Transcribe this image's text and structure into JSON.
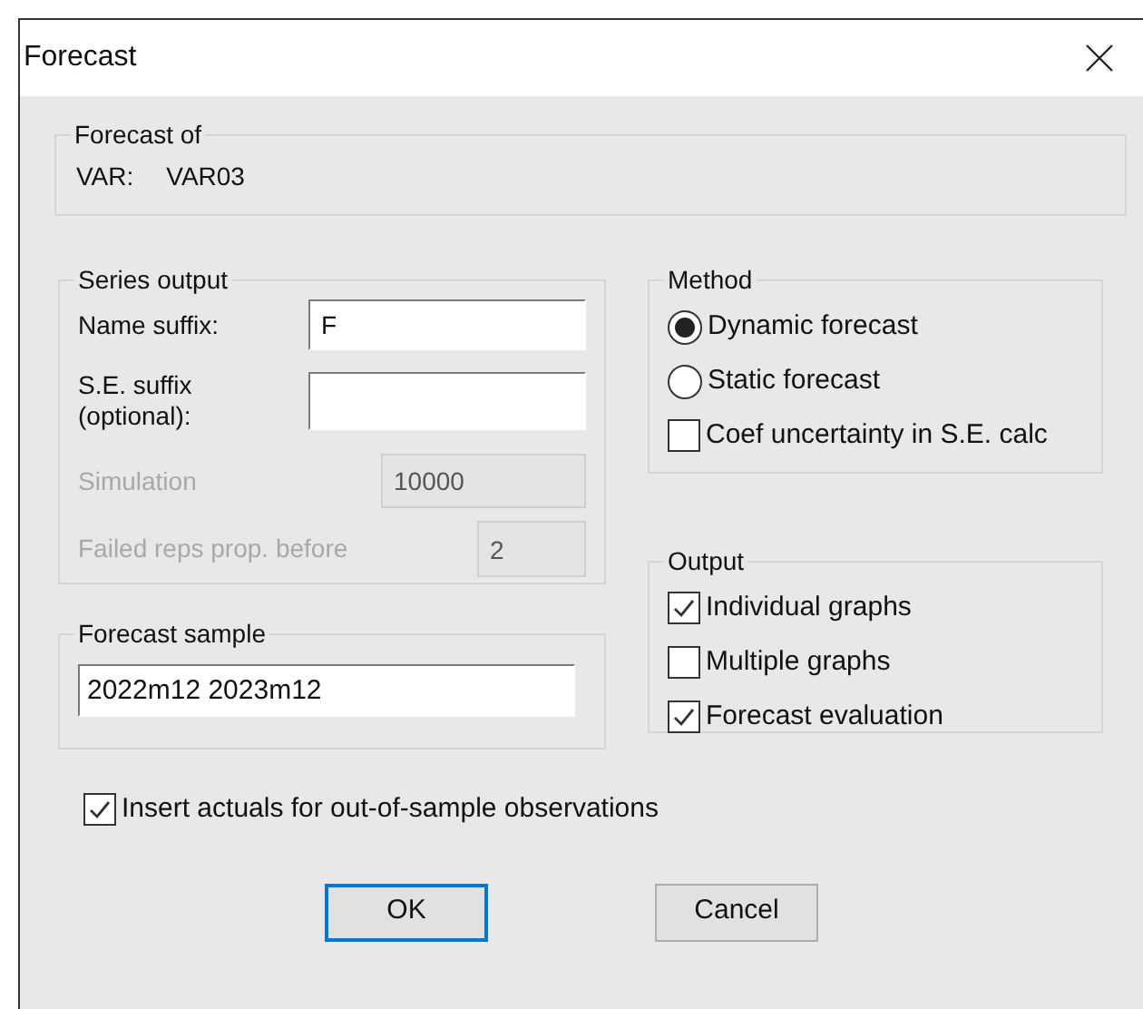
{
  "window": {
    "title": "Forecast"
  },
  "forecast_of": {
    "title": "Forecast of",
    "label": "VAR:",
    "value": "VAR03"
  },
  "series_output": {
    "title": "Series output",
    "fields": [
      {
        "label": "Name suffix:",
        "value": "F",
        "disabled": false
      },
      {
        "label": "S.E. suffix (optional):",
        "disabled": false
      },
      {
        "label": "Simulation",
        "value": "10000",
        "disabled": true
      },
      {
        "label": "Failed reps prop. before",
        "value": "2",
        "disabled": true
      }
    ]
  },
  "method": {
    "title": "Method",
    "options": [
      {
        "kind": "radio",
        "label": "Dynamic forecast",
        "selected": true
      },
      {
        "kind": "radio",
        "label": "Static forecast",
        "selected": false
      },
      {
        "kind": "checkbox",
        "label": "Coef uncertainty in S.E. calc",
        "checked": false
      }
    ]
  },
  "forecast_sample": {
    "title": "Forecast sample",
    "value": "2022m12 2023m12"
  },
  "output": {
    "title": "Output",
    "options": [
      {
        "label": "Individual graphs",
        "checked": true
      },
      {
        "label": "Multiple graphs",
        "checked": false
      },
      {
        "label": "Forecast evaluation",
        "checked": true
      }
    ]
  },
  "insert_actuals": {
    "label": "Insert actuals for out-of-sample observations",
    "checked": true
  },
  "buttons": [
    {
      "label": "OK",
      "default": true
    },
    {
      "label": "Cancel",
      "default": false
    }
  ]
}
